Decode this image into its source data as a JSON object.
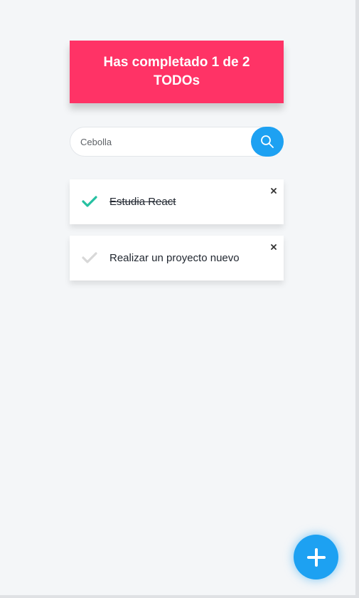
{
  "counter": {
    "text": "Has completado 1 de 2 TODOs"
  },
  "search": {
    "value": "",
    "placeholder": "Cebolla",
    "icon": "search-icon"
  },
  "todos": [
    {
      "text": "Estudia React",
      "completed": true,
      "check_color": "#25c0a1",
      "delete_icon": "close-icon"
    },
    {
      "text": "Realizar un proyecto nuevo",
      "completed": false,
      "check_color": "#d8d8d8",
      "delete_icon": "close-icon"
    }
  ],
  "fab": {
    "icon": "plus-icon"
  },
  "colors": {
    "accent_pink": "#ff3366",
    "accent_blue": "#1da1f2",
    "background": "#f4f6f8",
    "check_done": "#25c0a1",
    "check_pending": "#d8d8d8"
  }
}
